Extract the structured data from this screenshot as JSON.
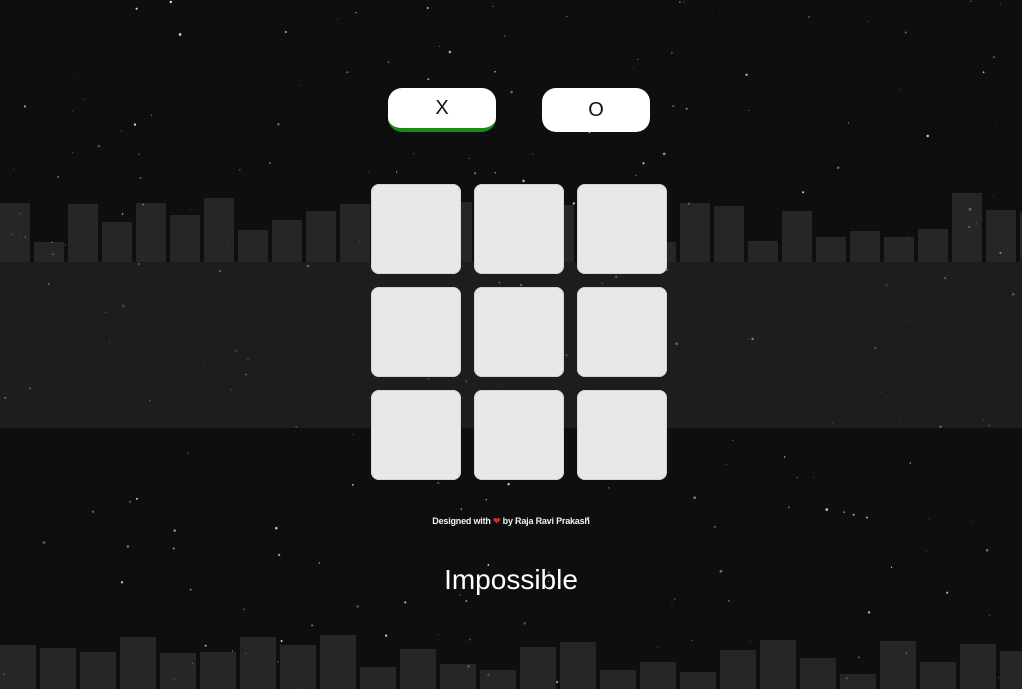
{
  "players": {
    "x_label": "X",
    "o_label": "O",
    "active": "X"
  },
  "board": {
    "cells": [
      "",
      "",
      "",
      "",
      "",
      "",
      "",
      "",
      ""
    ]
  },
  "footer": {
    "credit_prefix": "Designed with",
    "heart": "❤",
    "credit_suffix": "by Raja Ravi Prakash"
  },
  "difficulty": {
    "label": "Impossible"
  },
  "colors": {
    "background": "#0e0e0e",
    "button_bg": "#ffffff",
    "active_underline": "#1b8a1b",
    "cell_bg": "#e8e8e8",
    "heart": "#d12b2b",
    "text": "#ffffff"
  }
}
